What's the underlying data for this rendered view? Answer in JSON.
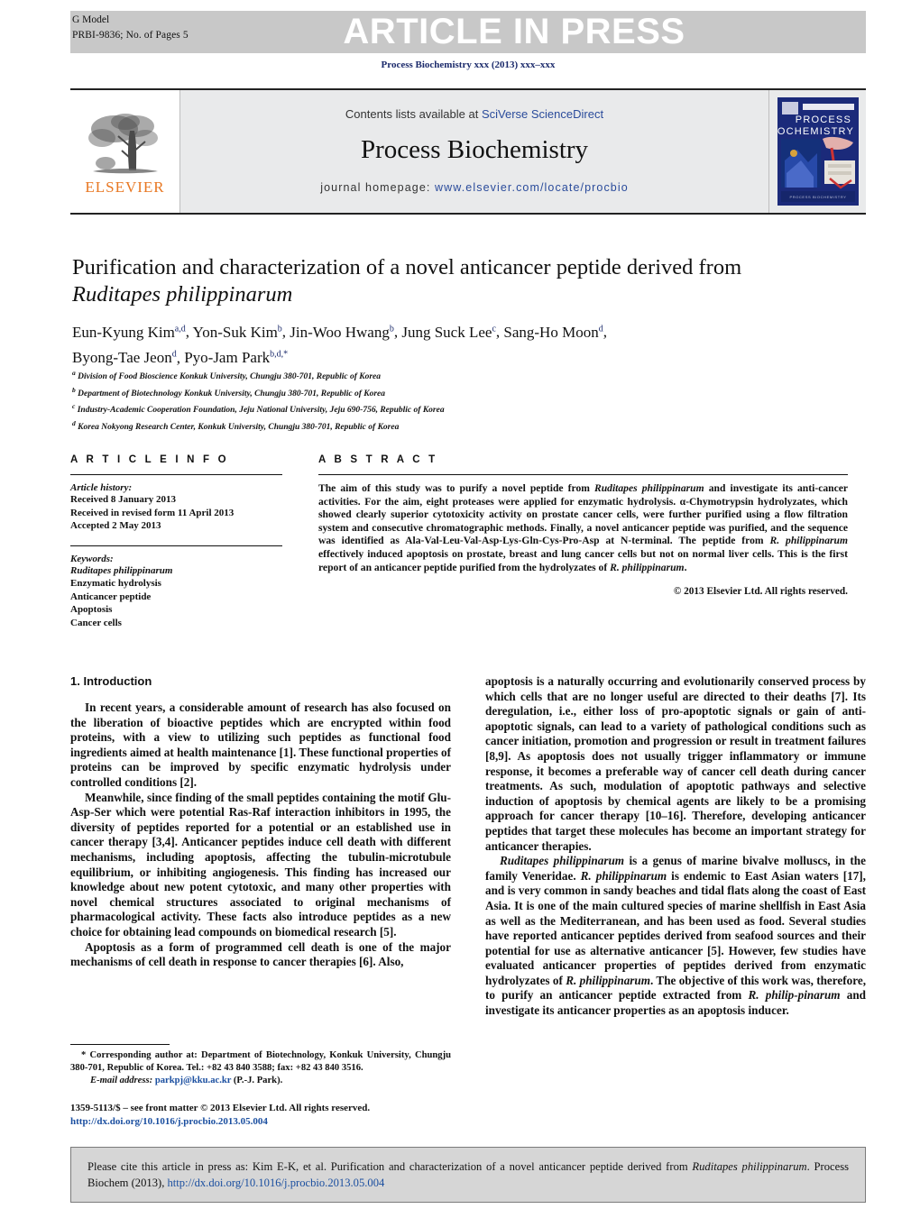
{
  "header": {
    "g_model": "G Model",
    "article_id": "PRBI-9836;   No. of Pages 5",
    "banner_text": "ARTICLE IN PRESS",
    "journal_ref": "Process Biochemistry xxx (2013) xxx–xxx"
  },
  "masthead": {
    "contents_prefix": "Contents lists available at ",
    "contents_link": "SciVerse ScienceDirect",
    "journal_title": "Process Biochemistry",
    "homepage_label": "journal homepage: ",
    "homepage_url": "www.elsevier.com/locate/procbio",
    "publisher": "ELSEVIER",
    "cover_line1": "PROCESS",
    "cover_line2": "BIOCHEMISTRY"
  },
  "article": {
    "title_line1": "Purification and characterization of a novel anticancer peptide derived from",
    "title_species": "Ruditapes philippinarum",
    "authors_line1_parts": [
      {
        "name": "Eun-Kyung Kim",
        "sup": "a,d"
      },
      {
        "name": "Yon-Suk Kim",
        "sup": "b"
      },
      {
        "name": "Jin-Woo Hwang",
        "sup": "b"
      },
      {
        "name": "Jung Suck Lee",
        "sup": "c"
      },
      {
        "name": "Sang-Ho Moon",
        "sup": "d"
      }
    ],
    "authors_line2_parts": [
      {
        "name": "Byong-Tae Jeon",
        "sup": "d"
      },
      {
        "name": "Pyo-Jam Park",
        "sup": "b,d,*"
      }
    ],
    "affiliations": [
      {
        "mark": "a",
        "text": "Division of Food Bioscience Konkuk University, Chungju 380-701, Republic of Korea"
      },
      {
        "mark": "b",
        "text": "Department of Biotechnology Konkuk University, Chungju 380-701, Republic of Korea"
      },
      {
        "mark": "c",
        "text": "Industry-Academic Cooperation Foundation, Jeju National University, Jeju 690-756, Republic of Korea"
      },
      {
        "mark": "d",
        "text": "Korea Nokyong Research Center, Konkuk University, Chungju 380-701, Republic of Korea"
      }
    ]
  },
  "article_info": {
    "heading": "A R T I C L E   I N F O",
    "history_label": "Article history:",
    "history": [
      "Received 8 January 2013",
      "Received in revised form 11 April 2013",
      "Accepted 2 May 2013"
    ],
    "keywords_label": "Keywords:",
    "keywords": [
      "Ruditapes philippinarum",
      "Enzymatic hydrolysis",
      "Anticancer peptide",
      "Apoptosis",
      "Cancer cells"
    ]
  },
  "abstract": {
    "heading": "A B S T R A C T",
    "text_part1": "The aim of this study was to purify a novel peptide from ",
    "species1": "Ruditapes philippinarum",
    "text_part2": " and investigate its anti-cancer activities. For the aim, eight proteases were applied for enzymatic hydrolysis. α-Chymotrypsin hydrolyzates, which showed clearly superior cytotoxicity activity on prostate cancer cells, were further purified using a flow filtration system and consecutive chromatographic methods. Finally, a novel anticancer peptide was purified, and the sequence was identified as Ala-Val-Leu-Val-Asp-Lys-Gln-Cys-Pro-Asp at N-terminal. The peptide from ",
    "species2": "R. philippinarum",
    "text_part3": " effectively induced apoptosis on prostate, breast and lung cancer cells but not on normal liver cells. This is the first report of an anticancer peptide purified from the hydrolyzates of ",
    "species3": "R. philippinarum",
    "text_part4": ".",
    "copyright": "© 2013 Elsevier Ltd. All rights reserved."
  },
  "introduction": {
    "heading": "1.  Introduction",
    "p1": "In recent years, a considerable amount of research has also focused on the liberation of bioactive peptides which are encrypted within food proteins, with a view to utilizing such peptides as functional food ingredients aimed at health maintenance [1]. These functional properties of proteins can be improved by specific enzymatic hydrolysis under controlled conditions [2].",
    "p2": "Meanwhile, since finding of the small peptides containing the motif Glu-Asp-Ser which were potential Ras-Raf interaction inhibitors in 1995, the diversity of peptides reported for a potential or an established use in cancer therapy [3,4]. Anticancer peptides induce cell death with different mechanisms, including apoptosis, affecting the tubulin-microtubule equilibrium, or inhibiting angiogenesis. This finding has increased our knowledge about new potent cytotoxic, and many other properties with novel chemical structures associated to original mechanisms of pharmacological activity. These facts also introduce peptides as a new choice for obtaining lead compounds on biomedical research [5].",
    "p3": "Apoptosis as a form of programmed cell death is one of the major mechanisms of cell death in response to cancer therapies [6]. Also,",
    "p4": "apoptosis is a naturally occurring and evolutionarily conserved process by which cells that are no longer useful are directed to their deaths [7]. Its deregulation, i.e., either loss of pro-apoptotic signals or gain of anti-apoptotic signals, can lead to a variety of pathological conditions such as cancer initiation, promotion and progression or result in treatment failures [8,9]. As apoptosis does not usually trigger inflammatory or immune response, it becomes a preferable way of cancer cell death during cancer treatments. As such, modulation of apoptotic pathways and selective induction of apoptosis by chemical agents are likely to be a promising approach for cancer therapy [10–16]. Therefore, developing anticancer peptides that target these molecules has become an important strategy for anticancer therapies.",
    "p5_part1": "Ruditapes philippinarum",
    "p5_part2": " is a genus of marine bivalve molluscs, in the family Veneridae. ",
    "p5_species2": "R. philippinarum",
    "p5_part3": " is endemic to East Asian waters [17], and is very common in sandy beaches and tidal flats along the coast of East Asia. It is one of the main cultured species of marine shellfish in East Asia as well as the Mediterranean, and has been used as food. Several studies have reported anticancer peptides derived from seafood sources and their potential for use as alternative anticancer [5]. However, few studies have evaluated anticancer properties of peptides derived from enzymatic hydrolyzates of ",
    "p5_species3": "R. philippinarum",
    "p5_part4": ". The objective of this work was, therefore, to purify an anticancer peptide extracted from ",
    "p5_species4": "R. philip-pinarum",
    "p5_part5": " and investigate its anticancer properties as an apoptosis inducer."
  },
  "footnote": {
    "corresponding": "* Corresponding author at: Department of Biotechnology, Konkuk University, Chungju 380-701, Republic of Korea. Tel.: +82 43 840 3588; fax: +82 43 840 3516.",
    "email_label": "E-mail address:",
    "email": "parkpj@kku.ac.kr",
    "email_suffix": "(P.-J. Park).",
    "issn_line": "1359-5113/$ – see front matter © 2013 Elsevier Ltd. All rights reserved.",
    "doi_line": "http://dx.doi.org/10.1016/j.procbio.2013.05.004"
  },
  "cite_box": {
    "text_part1": "Please cite this article in press as: Kim E-K, et al. Purification and characterization of a novel anticancer peptide derived from ",
    "species": "Ruditapes philippinarum",
    "text_part2": ". Process Biochem (2013), ",
    "doi": "http://dx.doi.org/10.1016/j.procbio.2013.05.004"
  },
  "colors": {
    "banner_gray": "#c8c8c8",
    "link_blue": "#2a4b9b",
    "ref_blue": "#1b2a6b",
    "elsevier_orange": "#e87722",
    "cite_box_gray": "#d6d6d6"
  }
}
